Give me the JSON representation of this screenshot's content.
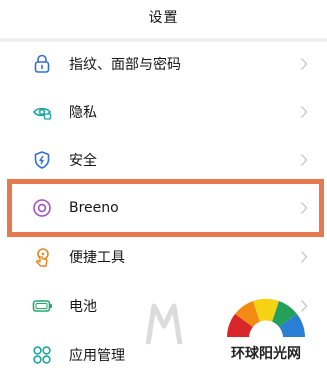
{
  "header": {
    "title": "设置"
  },
  "settings": {
    "items": [
      {
        "label": "指纹、面部与密码",
        "icon": "lock-icon"
      },
      {
        "label": "隐私",
        "icon": "privacy-eye-icon"
      },
      {
        "label": "安全",
        "icon": "shield-icon"
      },
      {
        "label": "Breeno",
        "icon": "breeno-ring-icon"
      },
      {
        "label": "便捷工具",
        "icon": "gesture-hand-icon"
      },
      {
        "label": "电池",
        "icon": "battery-icon"
      },
      {
        "label": "应用管理",
        "icon": "apps-grid-icon"
      }
    ]
  },
  "colors": {
    "icon_blue": "#2f6fd6",
    "icon_orange": "#e08a1e",
    "icon_green": "#23a86a",
    "icon_teal": "#1aa7a0",
    "icon_purple": "#a052c4",
    "highlight_border": "#e47a4e",
    "chevron": "#c4c4c4"
  },
  "watermark": {
    "brand_text": "环球阳光网"
  }
}
